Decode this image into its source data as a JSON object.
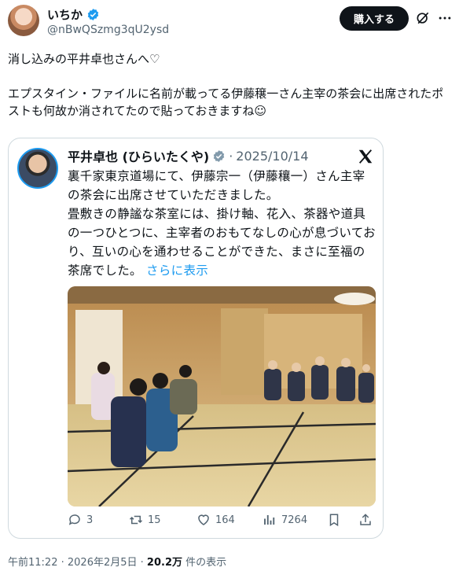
{
  "tweet": {
    "author_name": "いちか",
    "author_handle": "@nBwQSzmg3qU2ysd",
    "subscribe_label": "購入する",
    "text_line1": "消し込みの平井卓也さんへ♡",
    "text_line2": "エプスタイン・ファイルに名前が載ってる伊藤穣一さん主宰の茶会に出席されたポストも何故か消されてたので貼っておきますね☺"
  },
  "quote": {
    "author_name": "平井卓也 (ひらいたくや)",
    "date_sep": "·",
    "date": "2025/10/14",
    "text": "裏千家東京道場にて、伊藤宗一（伊藤穰一）さん主宰の茶会に出席させていただきました。\n畳敷きの静謐な茶室には、掛け軸、花入、茶器や道具の一つひとつに、主宰者のおもてなしの心が息づいており、互いの心を通わせることができた、まさに至福の茶席でした。",
    "show_more": "さらに表示",
    "replies": "3",
    "reposts": "15",
    "likes": "164",
    "views": "7264"
  },
  "footer": {
    "time": "午前11:22",
    "date": "2026年2月5日",
    "views_count": "20.2万",
    "views_label": "件の表示"
  },
  "icons": [
    "verified-icon",
    "grok-icon",
    "more-icon",
    "x-logo-icon",
    "reply-icon",
    "repost-icon",
    "like-icon",
    "views-icon",
    "bookmark-icon",
    "share-icon"
  ],
  "colors": {
    "accent": "#1d9bf0",
    "text": "#0f1419",
    "muted": "#536471",
    "border": "#cfd9de"
  }
}
